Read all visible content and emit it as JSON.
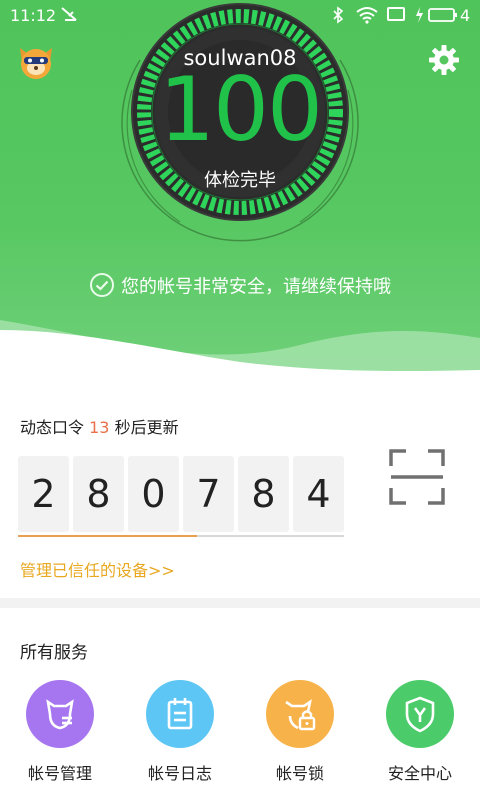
{
  "status_bar": {
    "time": "11:12",
    "battery": "4"
  },
  "header": {
    "username": "soulwan08",
    "score": "100",
    "check_status": "体检完毕"
  },
  "safety_message": "您的帐号非常安全，请继续保持哦",
  "otp": {
    "label_prefix": "动态口令",
    "seconds": "13",
    "label_suffix": "秒后更新",
    "digits": [
      "2",
      "8",
      "0",
      "7",
      "8",
      "4"
    ],
    "countdown_fraction": 0.55
  },
  "manage_devices_link": "管理已信任的设备>>",
  "services": {
    "title": "所有服务",
    "items": [
      {
        "label": "帐号管理",
        "icon": "account-manage-icon",
        "color": "#a576ef"
      },
      {
        "label": "帐号日志",
        "icon": "account-log-icon",
        "color": "#5dc6f4"
      },
      {
        "label": "帐号锁",
        "icon": "account-lock-icon",
        "color": "#f7b24a"
      },
      {
        "label": "安全中心",
        "icon": "security-center-icon",
        "color": "#4ccb6a"
      }
    ]
  },
  "colors": {
    "accent_green": "#4fc45a",
    "score_green": "#20c24a",
    "link_orange": "#e8a820"
  }
}
